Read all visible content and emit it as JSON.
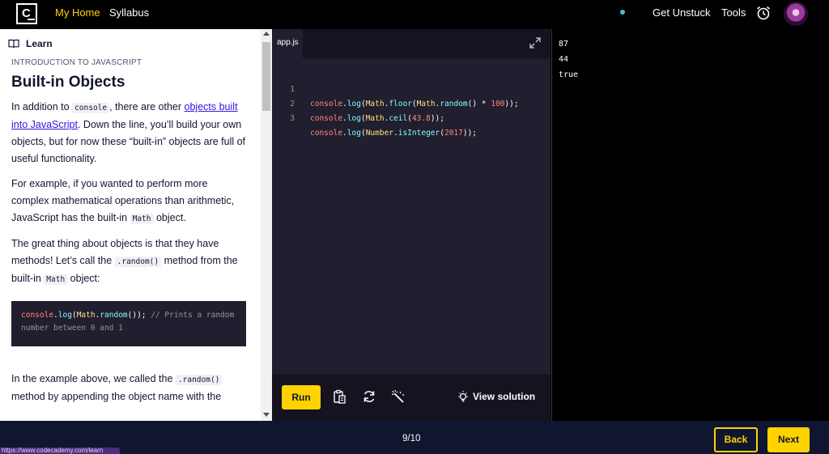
{
  "nav": {
    "logo_text": "C",
    "home": "My Home",
    "syllabus": "Syllabus",
    "unstuck": "Get Unstuck",
    "tools": "Tools",
    "status_dot_color": "#3cc8c8",
    "accent_color": "#ffd300"
  },
  "learn": {
    "header": "Learn",
    "eyebrow": "Introduction to JavaScript",
    "title": "Built-in Objects",
    "p1": {
      "a": "In addition to ",
      "code": "console",
      "b": ", there are other ",
      "link": "objects built into JavaScript",
      "c": ". Down the line, you’ll build your own objects, but for now these “built-in” objects are full of useful functionality."
    },
    "p2": {
      "a": "For example, if you wanted to perform more complex mathematical operations than arithmetic, JavaScript has the built-in ",
      "code": "Math",
      "b": " object."
    },
    "p3": {
      "a": "The great thing about objects is that they have methods! Let’s call the ",
      "code1": ".random()",
      "b": " method from the built-in ",
      "code2": "Math",
      "c": " object:"
    },
    "codeblock": {
      "fn": "console",
      "dot1": ".",
      "log": "log",
      "paren": "(",
      "obj": "Math",
      "dot2": ".",
      "random": "random",
      "end": "()); ",
      "comment": "// Prints a random number between 0 and 1"
    },
    "p4": {
      "a": "In the example above, we called the ",
      "code": ".random()",
      "b": " method by appending the object name with the"
    }
  },
  "editor": {
    "tab": "app.js",
    "lines": [
      {
        "num": "1"
      },
      {
        "num": "2"
      },
      {
        "num": "3"
      }
    ],
    "run": "Run",
    "view_solution": "View solution"
  },
  "output": [
    "87",
    "44",
    "true"
  ],
  "footer": {
    "progress": "9/10",
    "back": "Back",
    "next": "Next"
  },
  "status_url": "https://www.codecademy.com/learn"
}
